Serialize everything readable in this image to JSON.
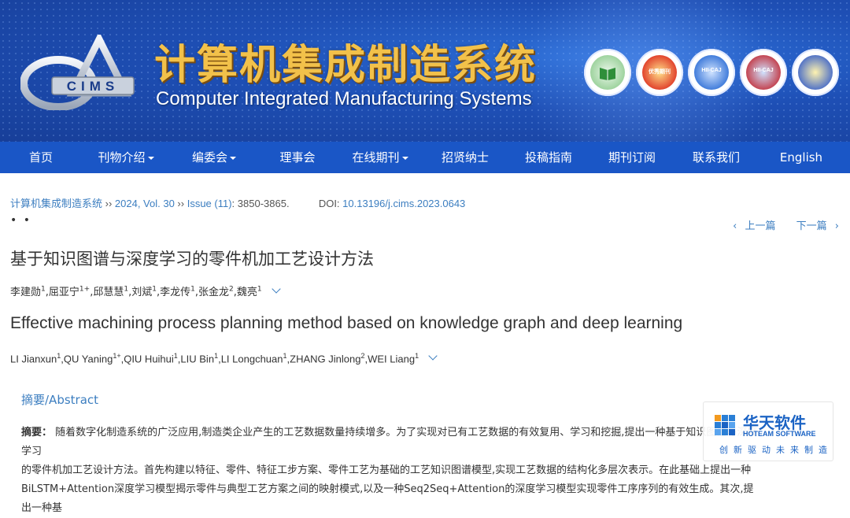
{
  "header": {
    "title_cn": "计算机集成制造系统",
    "title_en": "Computer Integrated Manufacturing Systems",
    "logo_text": "CIMS",
    "badges": [
      {
        "name": "badge-core-journal",
        "label": ""
      },
      {
        "name": "badge-excellent-journal",
        "label": "优秀期刊"
      },
      {
        "name": "badge-hii-caj-1",
        "label": "HII-CAJ"
      },
      {
        "name": "badge-hii-caj-2",
        "label": "HII-CAJ"
      },
      {
        "name": "badge-award",
        "label": ""
      }
    ]
  },
  "nav": {
    "items": [
      {
        "label": "首页",
        "dropdown": false
      },
      {
        "label": "刊物介绍",
        "dropdown": true
      },
      {
        "label": "编委会",
        "dropdown": true
      },
      {
        "label": "理事会",
        "dropdown": false
      },
      {
        "label": "在线期刊",
        "dropdown": true
      },
      {
        "label": "招贤纳士",
        "dropdown": false
      },
      {
        "label": "投稿指南",
        "dropdown": false
      },
      {
        "label": "期刊订阅",
        "dropdown": false
      },
      {
        "label": "联系我们",
        "dropdown": false
      },
      {
        "label": "English",
        "dropdown": false
      }
    ]
  },
  "citation": {
    "journal_link": "计算机集成制造系统",
    "sep1": " ›› ",
    "year_vol": "2024, Vol. 30",
    "sep2": " ›› ",
    "issue": "Issue (11)",
    "pages": ": 3850-3865.",
    "doi_label": "DOI:",
    "doi": "10.13196/j.cims.2023.0643"
  },
  "dots": "• •",
  "pager": {
    "prev": "上一篇",
    "next": "下一篇"
  },
  "article": {
    "title_cn": "基于知识图谱与深度学习的零件机加工艺设计方法",
    "authors_cn": [
      {
        "name": "李建勋",
        "aff": "1"
      },
      {
        "name": "屈亚宁",
        "aff": "1+"
      },
      {
        "name": "邱慧慧",
        "aff": "1"
      },
      {
        "name": "刘斌",
        "aff": "1"
      },
      {
        "name": "李龙传",
        "aff": "1"
      },
      {
        "name": "张金龙",
        "aff": "2"
      },
      {
        "name": "魏亮",
        "aff": "1"
      }
    ],
    "title_en": "Effective machining process planning method based on knowledge graph and deep learning",
    "authors_en": [
      {
        "name": "LI Jianxun",
        "aff": "1"
      },
      {
        "name": "QU Yaning",
        "aff": "1+"
      },
      {
        "name": "QIU Huihui",
        "aff": "1"
      },
      {
        "name": "LIU Bin",
        "aff": "1"
      },
      {
        "name": "LI Longchuan",
        "aff": "1"
      },
      {
        "name": "ZHANG Jinlong",
        "aff": "2"
      },
      {
        "name": "WEI Liang",
        "aff": "1"
      }
    ]
  },
  "abstract": {
    "heading": "摘要/Abstract",
    "label": "摘要：",
    "line1": "随着数字化制造系统的广泛应用,制造类企业产生的工艺数据数量持续增多。为了实现对已有工艺数据的有效复用、学习和挖掘,提出一种基于知识图谱与深度学习",
    "line2": "的零件机加工艺设计方法。首先构建以特征、零件、特征工步方案、零件工艺为基础的工艺知识图谱模型,实现工艺数据的结构化多层次表示。在此基础上提出一种",
    "line3": "BiLSTM+Attention深度学习模型揭示零件与典型工艺方案之间的映射模式,以及一种Seq2Seq+Attention的深度学习模型实现零件工序序列的有效生成。其次,提出一种基"
  },
  "watermark": {
    "brand_cn": "华天软件",
    "brand_en": "HOTEAM SOFTWARE",
    "slogan": "创新驱动未来制造"
  }
}
